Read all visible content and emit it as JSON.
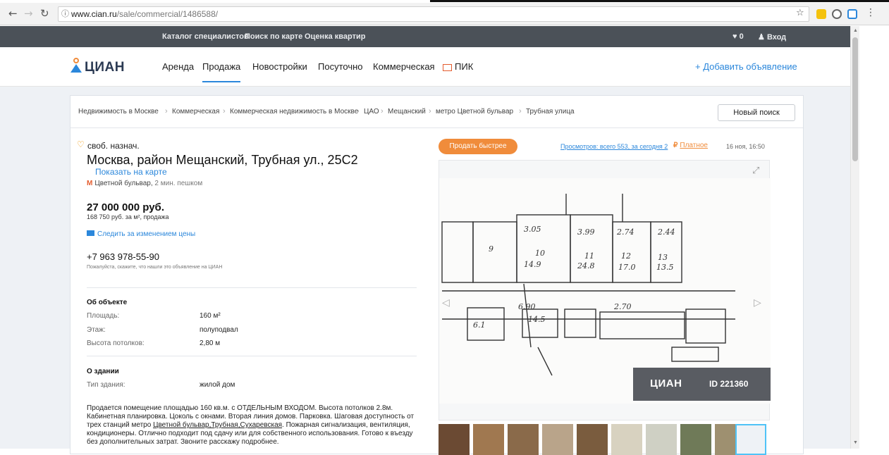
{
  "browser": {
    "url_host": "www.cian.ru",
    "url_path": "/sale/commercial/1486588/"
  },
  "topbar": {
    "links": [
      "Каталог специалистов",
      "Поиск по карте",
      "Оценка квартир"
    ],
    "fav_count": "0",
    "login": "Вход"
  },
  "nav": {
    "logo": "ЦИАН",
    "items": [
      "Аренда",
      "Продажа",
      "Новостройки",
      "Посуточно",
      "Коммерческая",
      "ПИК"
    ],
    "active": "Продажа",
    "add_listing": "+ Добавить объявление"
  },
  "breadcrumbs": [
    "Недвижимость в Москве",
    "Коммерческая",
    "Коммерческая недвижимость в Москве",
    "ЦАО",
    "Мещанский",
    "метро Цветной бульвар",
    "Трубная улица"
  ],
  "new_search": "Новый поиск",
  "listing": {
    "purpose": "своб. назнач.",
    "address": "Москва, район Мещанский, Трубная ул., 25С2",
    "map_link": "Показать на карте",
    "metro_icon": "М",
    "metro_name": "Цветной бульвар,",
    "metro_walk": " 2 мин. пешком",
    "price": "27 000 000 руб.",
    "price_per_meter": "168 750 руб. за м², продажа",
    "watch_price": "Следить за изменением цены",
    "phone": "+7 963 978-55-90",
    "phone_note": "Пожалуйста, скажите, что нашли это объявление на ЦИАН"
  },
  "about_object": {
    "title": "Об объекте",
    "rows": [
      {
        "label": "Площадь:",
        "value": "160 м²"
      },
      {
        "label": "Этаж:",
        "value": "полуподвал"
      },
      {
        "label": "Высота потолков:",
        "value": "2,80 м"
      }
    ]
  },
  "about_building": {
    "title": "О здании",
    "rows": [
      {
        "label": "Тип здания:",
        "value": "жилой дом"
      }
    ]
  },
  "description": {
    "part1": "Продается помещение площадью 160 кв.м. с ОТДЕЛЬНЫМ ВХОДОМ. Высота потолков 2.8м. Кабинетная планировка. Цоколь с окнами. Вторая линия домов. Парковка. Шаговая доступность от трех станций метро ",
    "links": "Цветной бульвар,Трубная,Сухаревская",
    "part2": ". Пожарная сигнализация, вентиляция, кондиционеры. Отлично подходит под сдачу или для собственного использования. Готово к въезду без дополнительных затрат. Звоните расскажу подробнее."
  },
  "aside": {
    "sell_faster": "Продать быстрее",
    "views": "Просмотров: всего 553, за сегодня 2",
    "paid_icon": "₽",
    "paid": "Платное",
    "date": "16 ноя, 16:50",
    "watermark_logo": "ЦИАН",
    "watermark_id": "ID 221360",
    "plan_labels": [
      "3.05",
      "3.99",
      "2.74",
      "2.44",
      "10",
      "11",
      "12",
      "13",
      "14.9",
      "24.8",
      "17.0",
      "13.5",
      "9",
      "6.90",
      "2.70",
      "14.5",
      "6.1"
    ]
  },
  "colors": {
    "accent": "#2b87db",
    "orange": "#f08c3b",
    "darkbar": "#4b5158"
  }
}
